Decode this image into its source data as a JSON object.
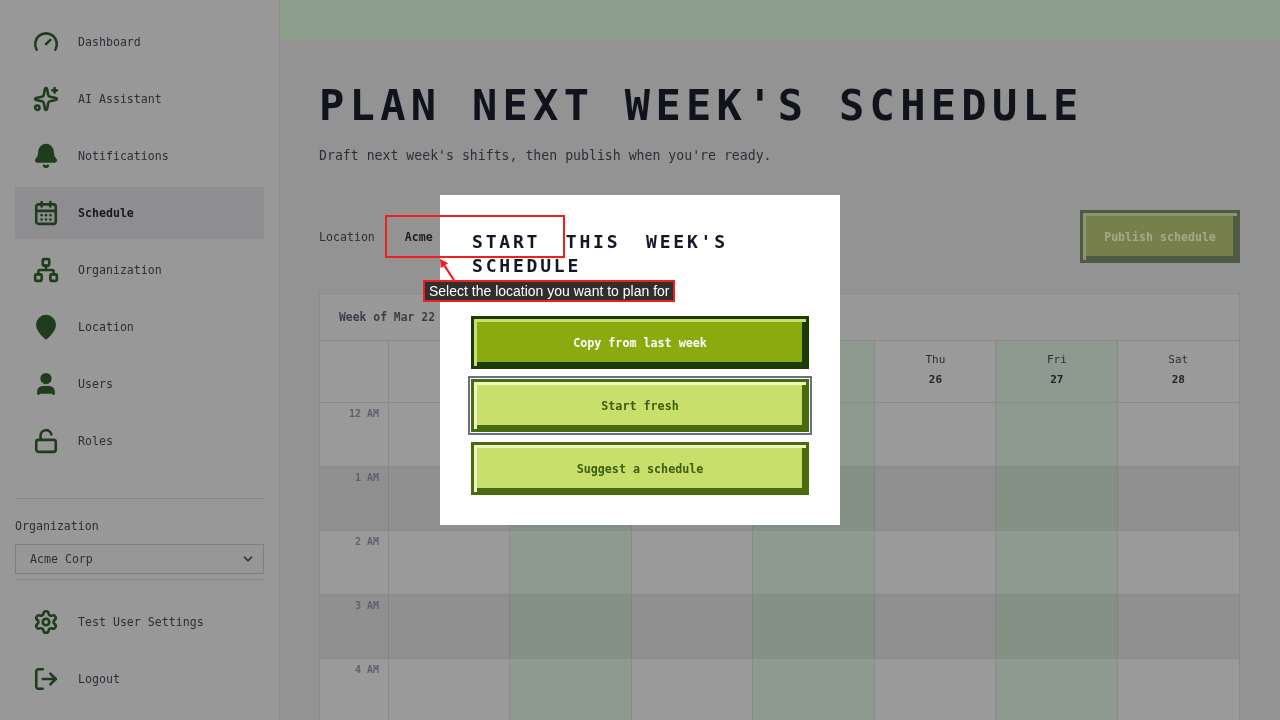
{
  "sidebar": {
    "items": [
      {
        "label": "Dashboard",
        "selected": false
      },
      {
        "label": "AI Assistant",
        "selected": false
      },
      {
        "label": "Notifications",
        "selected": false
      },
      {
        "label": "Schedule",
        "selected": true
      },
      {
        "label": "Organization",
        "selected": false
      },
      {
        "label": "Location",
        "selected": false
      },
      {
        "label": "Users",
        "selected": false
      },
      {
        "label": "Roles",
        "selected": false
      }
    ],
    "organization": {
      "label": "Organization",
      "value": "Acme Corp"
    },
    "footer_items": [
      {
        "label": "Test User Settings"
      },
      {
        "label": "Logout"
      }
    ]
  },
  "page": {
    "title": "PLAN NEXT WEEK'S SCHEDULE",
    "subtitle": "Draft next week's shifts, then publish when you're ready.",
    "location": {
      "label": "Location",
      "value": "Acme"
    },
    "publish_button": {
      "label": "Publish schedule",
      "disabled": true
    }
  },
  "calendar": {
    "week_label": "Week of Mar 22",
    "days": [
      {
        "kind": "covered"
      },
      {
        "kind": "covered"
      },
      {
        "kind": "covered"
      },
      {
        "kind": "covered"
      },
      {
        "kind": "day",
        "weekday": "Thu",
        "date": "26"
      },
      {
        "kind": "day",
        "weekday": "Fri",
        "date": "27"
      },
      {
        "kind": "day",
        "weekday": "Sat",
        "date": "28"
      }
    ],
    "hours": [
      "12 AM",
      "1 AM",
      "2 AM",
      "3 AM",
      "4 AM"
    ]
  },
  "modal": {
    "title": "START THIS WEEK'S SCHEDULE",
    "buttons": [
      {
        "label": "Copy from last week",
        "kind": "primary",
        "focused": false
      },
      {
        "label": "Start fresh",
        "kind": "secondary",
        "focused": true
      },
      {
        "label": "Suggest a schedule",
        "kind": "secondary",
        "focused": false
      }
    ]
  },
  "tour_tip": {
    "text": "Select the location you want to plan for"
  }
}
